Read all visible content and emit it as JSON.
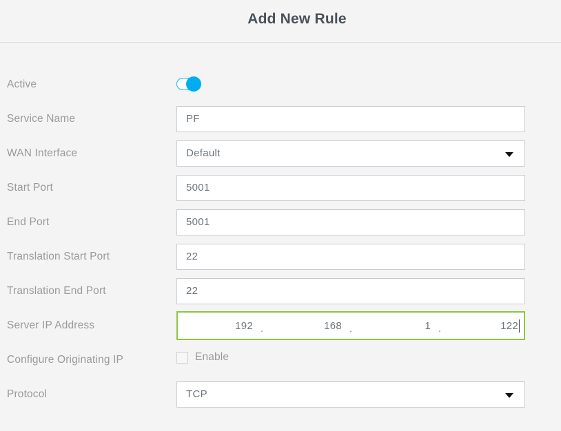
{
  "header": {
    "title": "Add New Rule"
  },
  "colors": {
    "page_background": "#f4f4f4",
    "divider": "#dcdcdc",
    "title_text": "#4a5159",
    "label_text": "#9a9a9a",
    "input_border": "#c7cbd1",
    "input_text": "#6c757d",
    "toggle_on": "#00aeef",
    "valid_border": "#8cc63f"
  },
  "form": {
    "rows": [
      {
        "label": "Active",
        "type": "toggle",
        "state": "on"
      },
      {
        "label": "Service Name",
        "type": "text",
        "value": "PF",
        "placeholder": ""
      },
      {
        "label": "WAN Interface",
        "type": "select",
        "value": "Default",
        "arrow_icon": "chevron-down-icon"
      },
      {
        "label": "Start Port",
        "type": "text",
        "value": "5001",
        "placeholder": ""
      },
      {
        "label": "End Port",
        "type": "text",
        "value": "5001",
        "placeholder": ""
      },
      {
        "label": "Translation Start Port",
        "type": "text",
        "value": "22",
        "placeholder": ""
      },
      {
        "label": "Translation End Port",
        "type": "text",
        "value": "22",
        "placeholder": ""
      },
      {
        "label": "Server IP Address",
        "type": "ip",
        "focused": true,
        "octets": [
          "192",
          "168",
          "1",
          "122"
        ],
        "separator": ".",
        "caret_after_octet": 3
      },
      {
        "label": "Configure Originating IP",
        "type": "checkbox",
        "checkbox_label": "Enable",
        "checked": false
      },
      {
        "label": "Protocol",
        "type": "select",
        "value": "TCP",
        "arrow_icon": "chevron-down-icon"
      }
    ]
  }
}
